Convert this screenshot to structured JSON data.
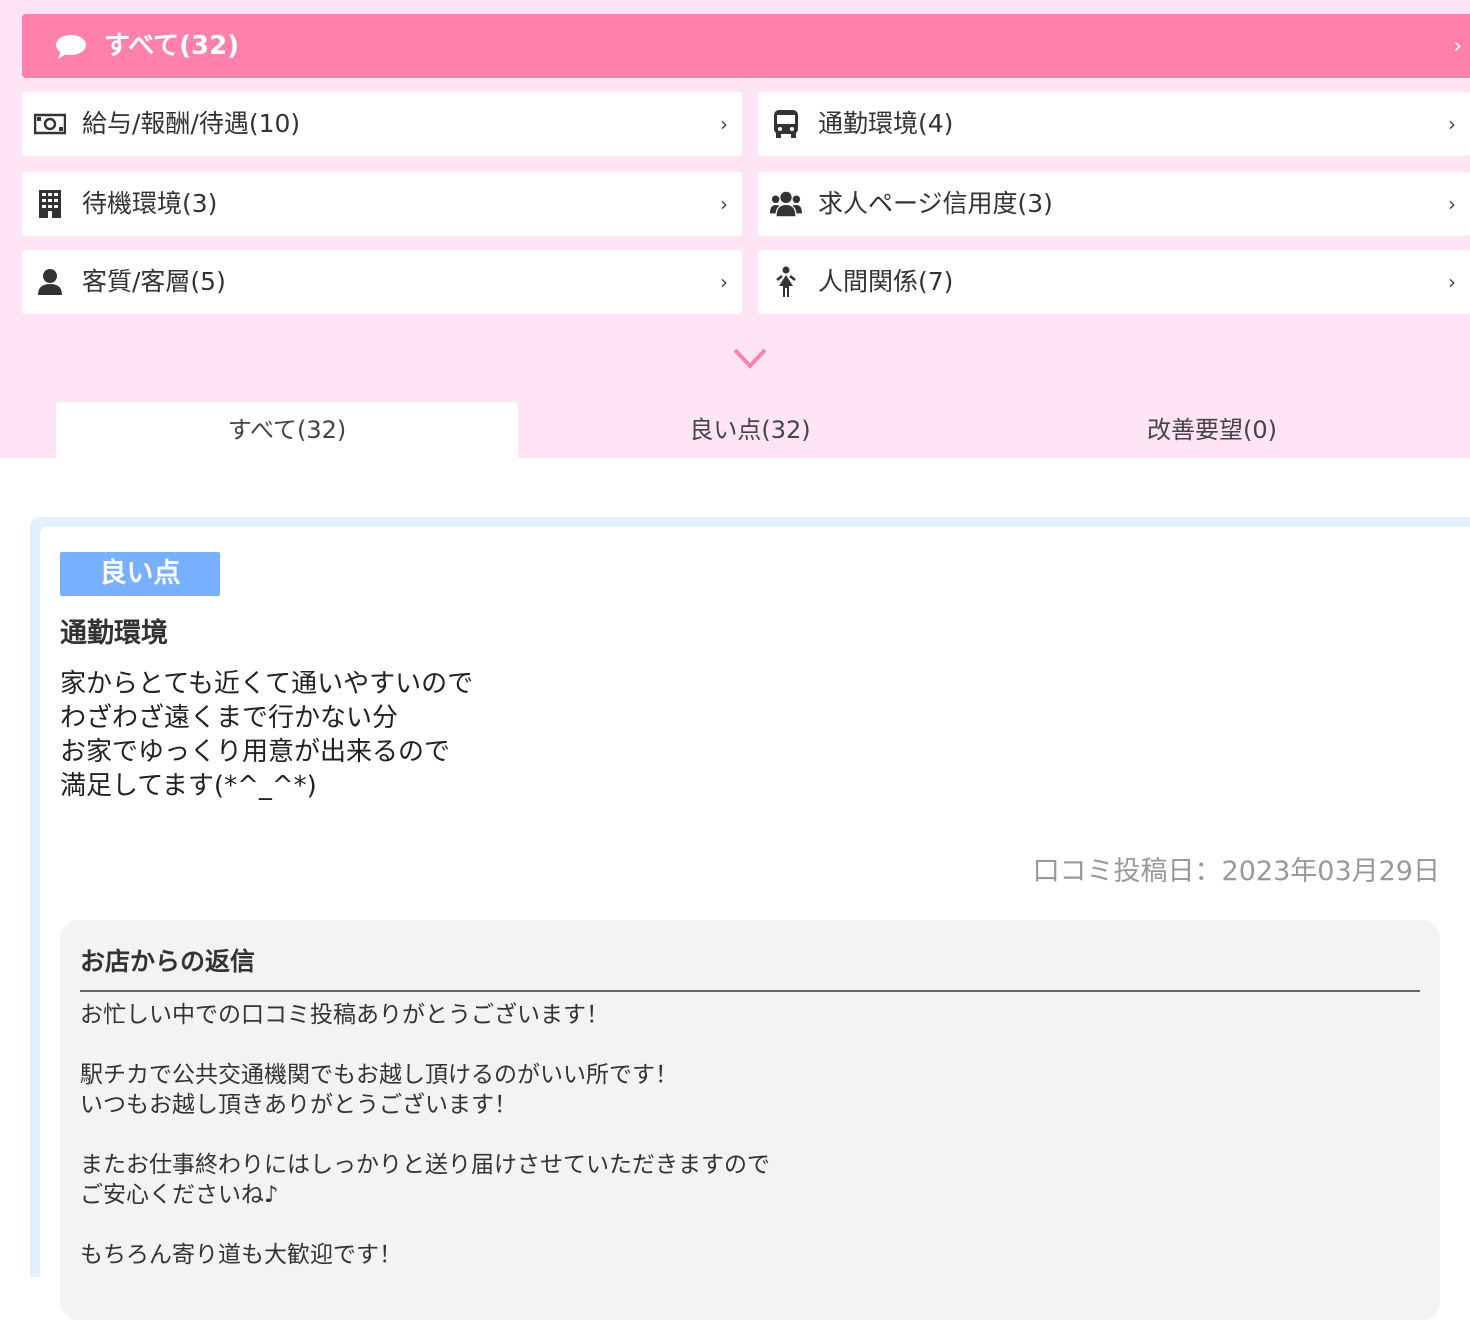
{
  "filter": {
    "all_label": "すべて(32)",
    "categories": [
      {
        "label": "給与/報酬/待遇(10)",
        "icon": "money-icon"
      },
      {
        "label": "通勤環境(4)",
        "icon": "bus-icon"
      },
      {
        "label": "待機環境(3)",
        "icon": "building-icon"
      },
      {
        "label": "求人ページ信用度(3)",
        "icon": "users-icon"
      },
      {
        "label": "客質/客層(5)",
        "icon": "user-icon"
      },
      {
        "label": "人間関係(7)",
        "icon": "female-icon"
      }
    ]
  },
  "tabs": [
    {
      "label": "すべて(32)",
      "active": true
    },
    {
      "label": "良い点(32)",
      "active": false
    },
    {
      "label": "改善要望(0)",
      "active": false
    }
  ],
  "review": {
    "badge": "良い点",
    "category": "通勤環境",
    "body": "家からとても近くて通いやすいので\nわざわざ遠くまで行かない分\nお家でゆっくり用意が出来るので\n満足してます(*^_^*)",
    "date": "口コミ投稿日：2023年03月29日",
    "reply": {
      "title": "お店からの返信",
      "body": "お忙しい中での口コミ投稿ありがとうございます！\n\n駅チカで公共交通機関でもお越し頂けるのがいい所です！\nいつもお越し頂きありがとうございます！\n\nまたお仕事終わりにはしっかりと送り届けさせていただきますので\nご安心くださいね♪\n\nもちろん寄り道も大歓迎です！"
    }
  },
  "colors": {
    "accent_pink": "#ff80aa",
    "bg_pink": "#ffe4f6",
    "badge_blue": "#78b0ff",
    "card_border": "#e2f0ff"
  }
}
